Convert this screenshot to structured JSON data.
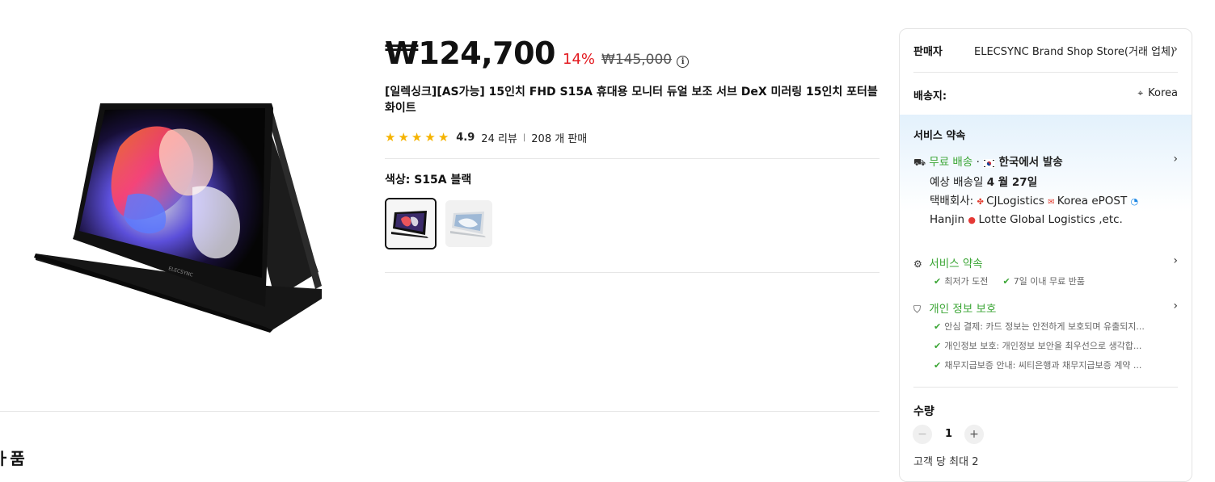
{
  "product": {
    "price": "₩124,700",
    "discount": "14%",
    "original_price": "₩145,000",
    "info_symbol": "i",
    "title": "[일렉싱크][AS가능] 15인치 FHD S15A 휴대용 모니터 듀얼 보조 서브 DeX 미러링 15인치 포터블 화이트",
    "rating": "4.9",
    "rating_stars": 5,
    "reviews": "24 리뷰",
    "sold": "208 개 판매",
    "color_label": "색상: S15A 블랙",
    "monitor_brand": "ELECSYNC"
  },
  "below_heading": "ㅏ품",
  "panel": {
    "seller_label": "판매자",
    "seller_name": "ELECSYNC Brand Shop Store(거래 업체)",
    "ship_to_label": "배송지:",
    "ship_to_value": "Korea",
    "service_heading": "서비스 약속",
    "free_shipping": "무료 배송",
    "dot": "·",
    "ship_from": "한국에서 발송",
    "eta_prefix": "예상 배송일",
    "eta_date": "4 월 27일",
    "carrier_label": "택배회사:",
    "carrier_cj": "CJLogistics",
    "carrier_korea": "Korea",
    "carrier_epost": "ePOST",
    "carrier_hanjin": "Hanjin",
    "carrier_lotte": "Lotte Global",
    "carrier_tail": "Logistics ,etc.",
    "promise_title": "서비스 약속",
    "promise_item1": "최저가 도전",
    "promise_item2": "7일 이내 무료 반품",
    "privacy_title": "개인 정보 보호",
    "privacy_item1": "안심 결제: 카드 정보는 안전하게 보호되며 유출되지...",
    "privacy_item2": "개인정보 보호: 개인정보 보안을 최우선으로 생각합...",
    "privacy_item3": "채무지급보증 안내: 씨티은행과 채무지급보증 계약 ...",
    "qty_label": "수량",
    "qty_value": "1",
    "qty_minus": "−",
    "qty_plus": "+",
    "qty_limit": "고객 당 최대 2"
  },
  "colors": {
    "accent_green": "#3aa534",
    "discount_red": "#e3191f",
    "star_yellow": "#f5b301",
    "service_band": "#e3f1fc"
  },
  "icons": [
    "truck-icon",
    "korea-flag-icon",
    "chevron-right-icon",
    "pin-icon",
    "badge-icon",
    "shield-icon",
    "check-icon",
    "info-icon",
    "star-icon"
  ]
}
